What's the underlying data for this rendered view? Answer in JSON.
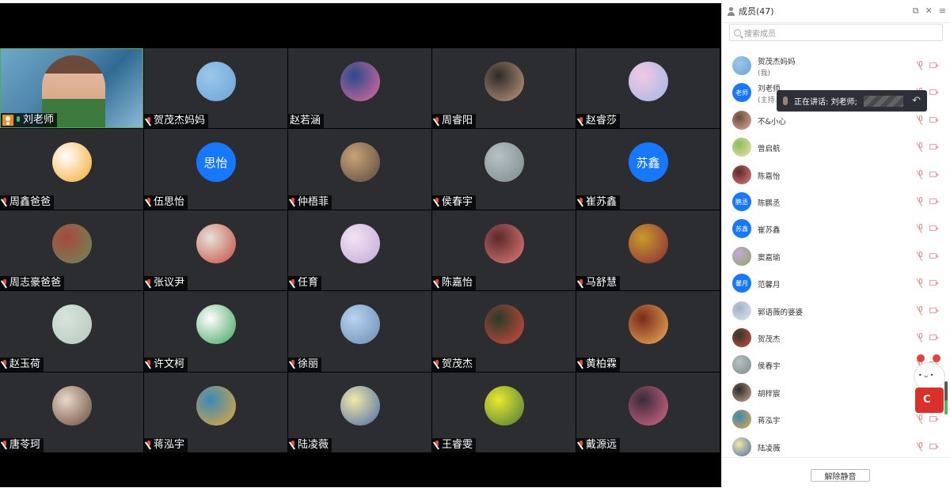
{
  "grid": {
    "tiles": [
      {
        "name": "刘老师",
        "type": "camera",
        "host": true,
        "mic": "on"
      },
      {
        "name": "贺茂杰妈妈",
        "type": "image",
        "colors": [
          "#9cc7ea",
          "#6aa4d6"
        ],
        "mic": "muted"
      },
      {
        "name": "赵若涵",
        "type": "image",
        "colors": [
          "#2a4a8a",
          "#e36b9c"
        ],
        "mic": "none"
      },
      {
        "name": "周睿阳",
        "type": "image",
        "colors": [
          "#2b2b2b",
          "#c49a7a"
        ],
        "mic": "muted"
      },
      {
        "name": "赵睿莎",
        "type": "image",
        "colors": [
          "#f3c9e3",
          "#9fb7e8"
        ],
        "mic": "muted"
      },
      {
        "name": "周鑫爸爸",
        "type": "image",
        "colors": [
          "#ffffff",
          "#f4a92a"
        ],
        "mic": "muted"
      },
      {
        "name": "伍思怡",
        "type": "text",
        "avatar_text": "思怡",
        "mic": "muted"
      },
      {
        "name": "仲梧菲",
        "type": "image",
        "colors": [
          "#c8a27a",
          "#5a4a3a"
        ],
        "mic": "muted"
      },
      {
        "name": "侯春宇",
        "type": "image",
        "colors": [
          "#b8c1c4",
          "#7a8a8e"
        ],
        "mic": "muted"
      },
      {
        "name": "崔苏鑫",
        "type": "text",
        "avatar_text": "苏鑫",
        "mic": "muted"
      },
      {
        "name": "周志豪爸爸",
        "type": "image",
        "colors": [
          "#a8483c",
          "#6a8a5a"
        ],
        "mic": "muted"
      },
      {
        "name": "张议尹",
        "type": "image",
        "colors": [
          "#e6e2da",
          "#c64a3c"
        ],
        "mic": "muted"
      },
      {
        "name": "任育",
        "type": "image",
        "colors": [
          "#f2e4f0",
          "#c2a7de"
        ],
        "mic": "muted"
      },
      {
        "name": "陈嘉怡",
        "type": "image",
        "colors": [
          "#5a2a2a",
          "#e67b7b"
        ],
        "mic": "muted"
      },
      {
        "name": "马舒慧",
        "type": "image",
        "colors": [
          "#c89a2a",
          "#8a2a3a"
        ],
        "mic": "muted"
      },
      {
        "name": "赵玉荷",
        "type": "image",
        "colors": [
          "#d8e4dc",
          "#b4c9bc"
        ],
        "mic": "muted"
      },
      {
        "name": "许文柯",
        "type": "image",
        "colors": [
          "#ffffff",
          "#3aa35a"
        ],
        "mic": "muted"
      },
      {
        "name": "徐丽",
        "type": "image",
        "colors": [
          "#b8d4f0",
          "#6a8ab0"
        ],
        "mic": "muted"
      },
      {
        "name": "贺茂杰",
        "type": "image",
        "colors": [
          "#2a3a2a",
          "#d84a3a"
        ],
        "mic": "muted"
      },
      {
        "name": "黄柏霖",
        "type": "image",
        "colors": [
          "#7a2a1a",
          "#f0b05a"
        ],
        "mic": "muted"
      },
      {
        "name": "唐苓珂",
        "type": "image",
        "colors": [
          "#e8d8c8",
          "#6a4a3a"
        ],
        "mic": "muted"
      },
      {
        "name": "蒋泓宇",
        "type": "image",
        "colors": [
          "#3a8ab8",
          "#e8a838"
        ],
        "mic": "muted"
      },
      {
        "name": "陆凌薇",
        "type": "image",
        "colors": [
          "#f2e8a8",
          "#4a6aa8"
        ],
        "mic": "muted"
      },
      {
        "name": "王睿雯",
        "type": "image",
        "colors": [
          "#e8e830",
          "#4a7a3a"
        ],
        "mic": "muted"
      },
      {
        "name": "戴源远",
        "type": "image",
        "colors": [
          "#3a2a3a",
          "#d86a8a"
        ],
        "mic": "muted"
      }
    ]
  },
  "panel": {
    "title": "成员(47)",
    "search_placeholder": "搜索成员",
    "members": [
      {
        "name": "贺茂杰妈妈",
        "sub": "(我)",
        "type": "image",
        "colors": [
          "#9cc7ea",
          "#6aa4d6"
        ]
      },
      {
        "name": "刘老师",
        "sub": "(主持...",
        "type": "text",
        "avatar_text": "老师"
      },
      {
        "name": "不&小心",
        "type": "image",
        "colors": [
          "#6a4a3a",
          "#e0b0a0"
        ]
      },
      {
        "name": "曾启航",
        "type": "image",
        "colors": [
          "#8abf5a",
          "#f0e0b0"
        ]
      },
      {
        "name": "陈嘉怡",
        "type": "image",
        "colors": [
          "#5a2a2a",
          "#e67b7b"
        ]
      },
      {
        "name": "陈鹏丞",
        "type": "text",
        "avatar_text": "鹏丞"
      },
      {
        "name": "崔苏鑫",
        "type": "text",
        "avatar_text": "苏鑫"
      },
      {
        "name": "窦嘉瑜",
        "type": "image",
        "colors": [
          "#c8a8e0",
          "#8aa85a"
        ]
      },
      {
        "name": "范馨月",
        "type": "text",
        "avatar_text": "馨月"
      },
      {
        "name": "郭语薇的婆婆",
        "type": "image",
        "colors": [
          "#a0b0c8",
          "#e0e8f0"
        ]
      },
      {
        "name": "贺茂杰",
        "type": "image",
        "colors": [
          "#2a3a2a",
          "#d84a3a"
        ]
      },
      {
        "name": "侯春宇",
        "type": "image",
        "colors": [
          "#b8c1c4",
          "#7a8a8e"
        ]
      },
      {
        "name": "胡梓宸",
        "type": "image",
        "colors": [
          "#2a2a2a",
          "#c8a890"
        ]
      },
      {
        "name": "蒋泓宇",
        "type": "image",
        "colors": [
          "#3a8ab8",
          "#e8a838"
        ]
      },
      {
        "name": "陆凌薇",
        "type": "image",
        "colors": [
          "#f2e8a8",
          "#4a6aa8"
        ]
      }
    ],
    "speaking": {
      "label": "正在讲话: 刘老师;"
    },
    "footer": {
      "unmute_label": "解除静音"
    }
  }
}
